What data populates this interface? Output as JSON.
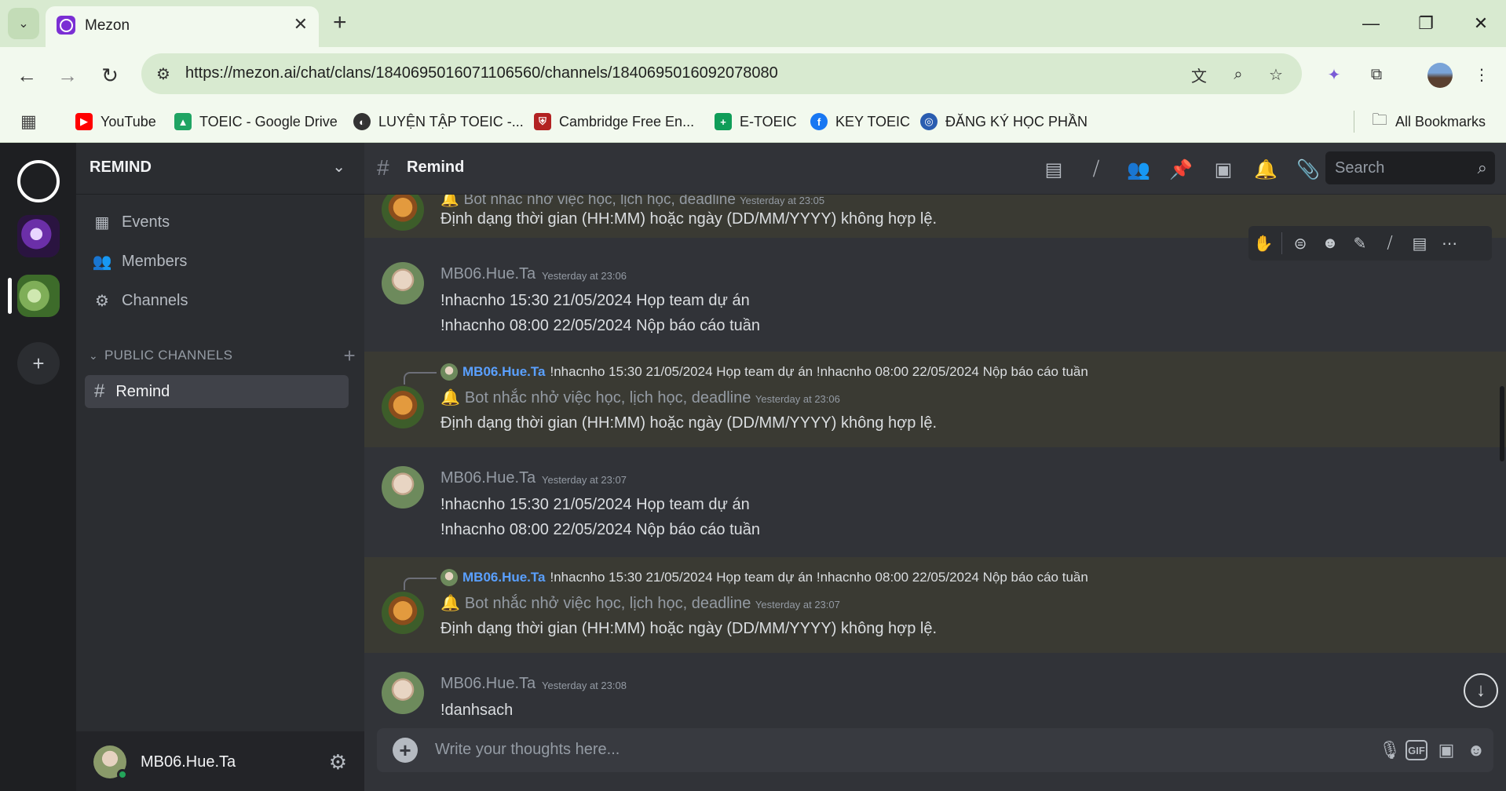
{
  "browser": {
    "tab_title": "Mezon",
    "tab_close": "✕",
    "new_tab": "+",
    "url": "https://mezon.ai/chat/clans/1840695016071106560/channels/1840695016092078080",
    "bookmarks": [
      {
        "label": "YouTube",
        "color": "#ff0000",
        "glyph": "▶"
      },
      {
        "label": "TOEIC - Google Drive",
        "color": "#1fa463",
        "glyph": "▲"
      },
      {
        "label": "LUYỆN TẬP TOEIC -...",
        "color": "#333333",
        "glyph": "◐"
      },
      {
        "label": "Cambridge Free En...",
        "color": "#b22222",
        "glyph": "⛨"
      },
      {
        "label": "E-TOEIC",
        "color": "#0f9d58",
        "glyph": "+"
      },
      {
        "label": "KEY TOEIC",
        "color": "#1877f2",
        "glyph": "f"
      },
      {
        "label": "ĐĂNG KÝ HỌC PHẦN",
        "color": "#2a5db0",
        "glyph": "◎"
      }
    ],
    "all_bookmarks": "All Bookmarks"
  },
  "sidebar": {
    "clan_name": "REMIND",
    "items": [
      {
        "label": "Events"
      },
      {
        "label": "Members"
      },
      {
        "label": "Channels"
      }
    ],
    "section_title": "PUBLIC CHANNELS",
    "channel": "Remind",
    "user_name": "MB06.Hue.Ta"
  },
  "chat": {
    "channel_title": "Remind",
    "search_placeholder": "Search",
    "composer_placeholder": "Write your thoughts here...",
    "messages": [
      {
        "type": "bot",
        "name": "Bot nhắc nhở việc học, lịch học, deadline",
        "time": "Yesterday at 23:05",
        "text": "Định dạng thời gian (HH:MM) hoặc ngày (DD/MM/YYYY) không hợp lệ."
      },
      {
        "type": "user",
        "name": "MB06.Hue.Ta",
        "time": "Yesterday at 23:06",
        "lines": [
          "!nhacnho 15:30 21/05/2024 Họp team dự án",
          "!nhacnho 08:00 22/05/2024 Nộp báo cáo tuần"
        ]
      },
      {
        "type": "bot",
        "reply_name": "MB06.Hue.Ta",
        "reply_text": "!nhacnho 15:30 21/05/2024 Họp team dự án !nhacnho 08:00 22/05/2024 Nộp báo cáo tuần",
        "name": "Bot nhắc nhở việc học, lịch học, deadline",
        "time": "Yesterday at 23:06",
        "text": "Định dạng thời gian (HH:MM) hoặc ngày (DD/MM/YYYY) không hợp lệ."
      },
      {
        "type": "user",
        "name": "MB06.Hue.Ta",
        "time": "Yesterday at 23:07",
        "lines": [
          "!nhacnho 15:30 21/05/2024 Họp team dự án",
          "!nhacnho 08:00 22/05/2024 Nộp báo cáo tuần"
        ]
      },
      {
        "type": "bot",
        "reply_name": "MB06.Hue.Ta",
        "reply_text": "!nhacnho 15:30 21/05/2024 Họp team dự án !nhacnho 08:00 22/05/2024 Nộp báo cáo tuần",
        "name": "Bot nhắc nhở việc học, lịch học, deadline",
        "time": "Yesterday at 23:07",
        "text": "Định dạng thời gian (HH:MM) hoặc ngày (DD/MM/YYYY) không hợp lệ."
      },
      {
        "type": "user",
        "name": "MB06.Hue.Ta",
        "time": "Yesterday at 23:08",
        "lines": [
          "!danhsach"
        ]
      }
    ]
  },
  "icons": {
    "bell": "🔔",
    "composer_icons": [
      "microphone-icon",
      "gif-icon",
      "sticker-icon",
      "emoji-icon"
    ],
    "header_icons": [
      "threads-icon",
      "mute-icon",
      "members-icon",
      "pin-icon",
      "inbox-icon",
      "notification-bell-icon",
      "attachment-icon"
    ]
  },
  "colors": {
    "bot_highlight": "#3a3a33",
    "reply_name": "#5aa0ff",
    "online": "#23a55a"
  }
}
